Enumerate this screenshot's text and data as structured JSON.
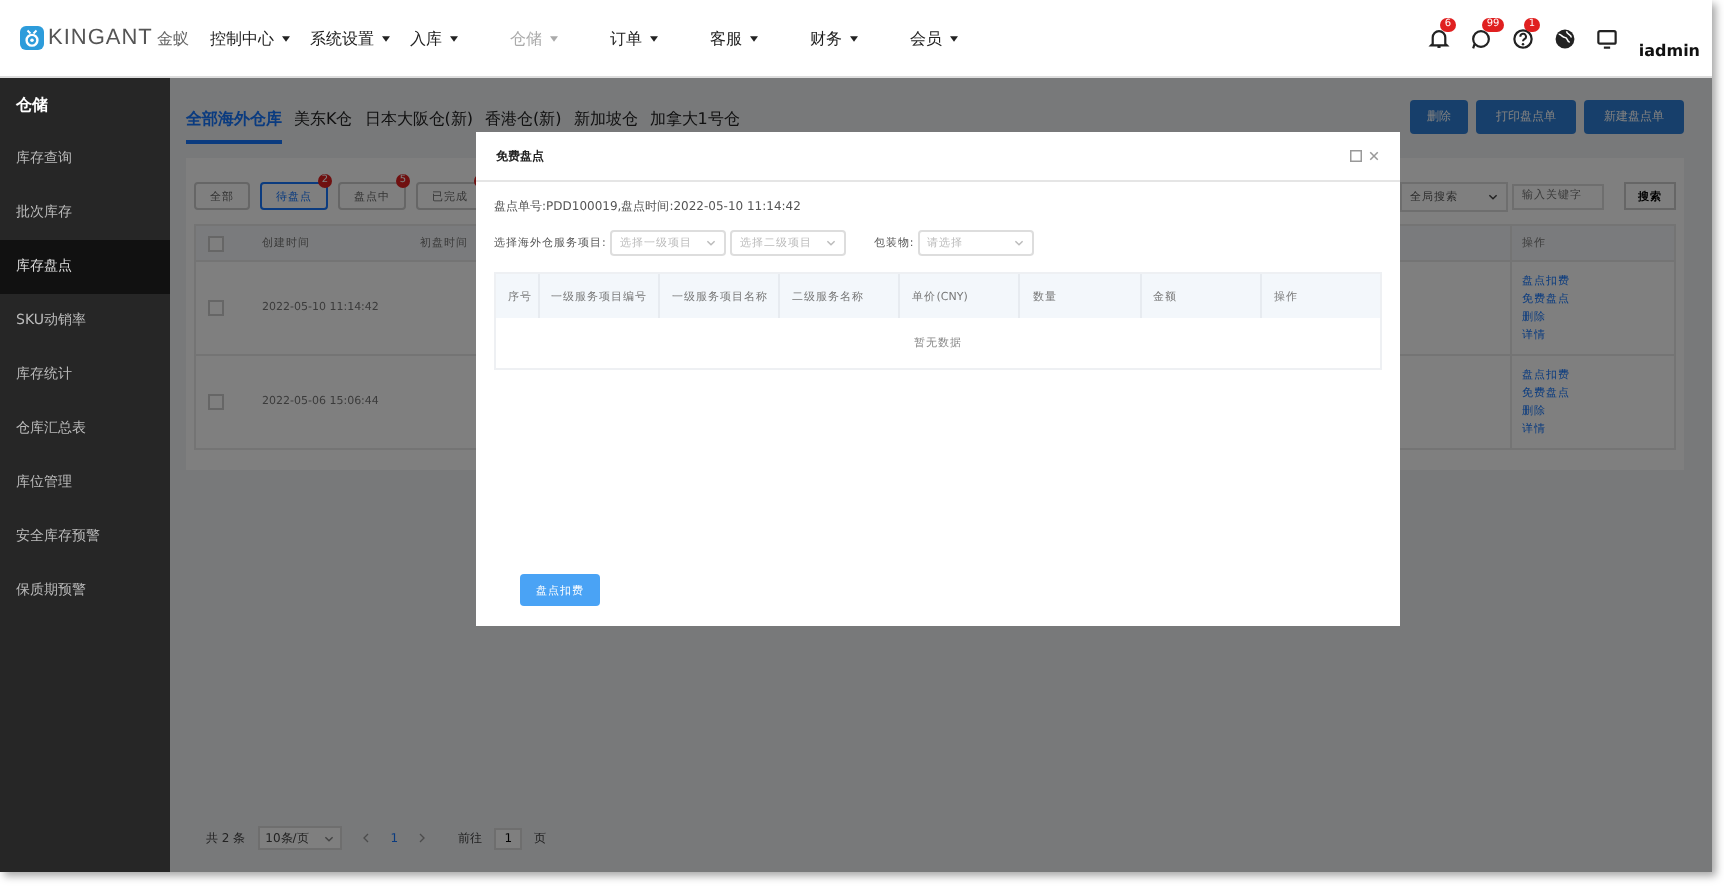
{
  "brand": {
    "name": "KINGANT",
    "name_cn": "金蚁"
  },
  "nav": [
    {
      "label": "控制中心",
      "selected": false
    },
    {
      "label": "系统设置",
      "selected": false
    },
    {
      "label": "入库",
      "selected": false
    },
    {
      "label": "仓储",
      "selected": true
    },
    {
      "label": "订单",
      "selected": false
    },
    {
      "label": "客服",
      "selected": false
    },
    {
      "label": "财务",
      "selected": false
    },
    {
      "label": "会员",
      "selected": false
    }
  ],
  "header_icons": [
    {
      "kind": "bell",
      "badge": "6"
    },
    {
      "kind": "chat",
      "badge": "99"
    },
    {
      "kind": "help",
      "badge": "1"
    },
    {
      "kind": "globe"
    },
    {
      "kind": "monitor"
    }
  ],
  "user": "iadmin",
  "sidebar": {
    "title": "仓储",
    "items": [
      {
        "label": "库存查询",
        "selected": false
      },
      {
        "label": "批次库存",
        "selected": false
      },
      {
        "label": "库存盘点",
        "selected": true
      },
      {
        "label": "SKU动销率",
        "selected": false
      },
      {
        "label": "库存统计",
        "selected": false
      },
      {
        "label": "仓库汇总表",
        "selected": false
      },
      {
        "label": "库位管理",
        "selected": false
      },
      {
        "label": "安全库存预警",
        "selected": false
      },
      {
        "label": "保质期预警",
        "selected": false
      }
    ]
  },
  "warehouse_tabs": [
    {
      "label": "全部海外仓库",
      "selected": true
    },
    {
      "label": "美东K仓",
      "selected": false
    },
    {
      "label": "日本大阪仓(新)",
      "selected": false
    },
    {
      "label": "香港仓(新)",
      "selected": false
    },
    {
      "label": "新加坡仓",
      "selected": false
    },
    {
      "label": "加拿大1号仓",
      "selected": false
    }
  ],
  "actions": [
    "删除",
    "打印盘点单",
    "新建盘点单"
  ],
  "status_filters": [
    {
      "label": "全部",
      "selected": false,
      "has_badge": false
    },
    {
      "label": "待盘点",
      "selected": true,
      "has_badge": true,
      "badge": "2"
    },
    {
      "label": "盘点中",
      "selected": false,
      "has_badge": true,
      "badge": "5"
    },
    {
      "label": "已完成",
      "selected": false,
      "has_badge": true
    }
  ],
  "search": {
    "scope": "全局搜索",
    "placeholder": "输入关键字",
    "button": "搜索"
  },
  "table": {
    "all_checked": false,
    "columns": [
      "创建时间",
      "初盘时间"
    ],
    "action_column": "操作",
    "rows": [
      {
        "created": "2022-05-10 11:14:42",
        "checked": false,
        "actions": [
          "盘点扣费",
          "免费盘点",
          "删除",
          "详情"
        ]
      },
      {
        "created": "2022-05-06 15:06:44",
        "checked": false,
        "actions": [
          "盘点扣费",
          "免费盘点",
          "删除",
          "详情"
        ]
      }
    ]
  },
  "pagination": {
    "total": "共 2 条",
    "page_size": "10条/页",
    "current": "1",
    "goto_label": "前往",
    "goto_value": "1",
    "page_unit": "页"
  },
  "dialog": {
    "title": "免费盘点",
    "info": "盘点单号:PDD100019,盘点时间:2022-05-10 11:14:42",
    "service_label": "选择海外仓服务项目:",
    "level1_placeholder": "选择一级项目",
    "level2_placeholder": "选择二级项目",
    "package_label": "包装物:",
    "package_placeholder": "请选择",
    "columns": [
      "序号",
      "一级服务项目编号",
      "一级服务项目名称",
      "二级服务名称",
      "单价(CNY)",
      "数量",
      "金额",
      "操作"
    ],
    "empty": "暂无数据",
    "button": "盘点扣费"
  }
}
